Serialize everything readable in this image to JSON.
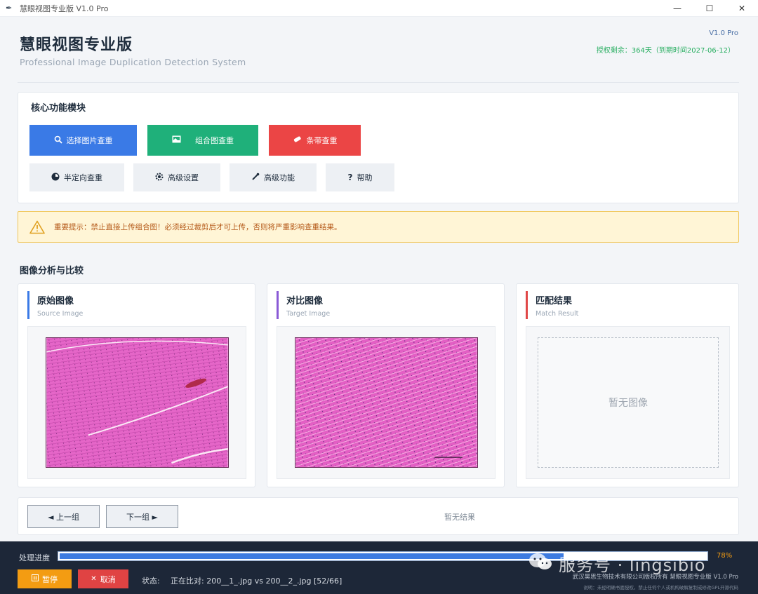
{
  "window": {
    "title": "慧眼视图专业版 V1.0 Pro",
    "app_icon": "feather-icon",
    "controls": {
      "minimize": "—",
      "maximize": "☐",
      "close": "✕"
    }
  },
  "header": {
    "title": "慧眼视图专业版",
    "subtitle": "Professional Image Duplication Detection System",
    "version": "V1.0 Pro",
    "license": "授权剩余：364天（到期时间2027-06-12）"
  },
  "core": {
    "title": "核心功能模块",
    "primary_buttons": [
      {
        "label": "选择图片查重",
        "icon": "search-icon",
        "color": "#3a7ae6"
      },
      {
        "label": "组合图查重",
        "icon": "image-icon",
        "color": "#1fb07a"
      },
      {
        "label": "条带查重",
        "icon": "strip-icon",
        "color": "#eb4545"
      }
    ],
    "secondary_buttons": [
      {
        "label": "半定向查重",
        "icon": "target-icon"
      },
      {
        "label": "高级设置",
        "icon": "gear-icon"
      },
      {
        "label": "高级功能",
        "icon": "wrench-icon"
      },
      {
        "label": "帮助",
        "icon": "question-icon"
      }
    ]
  },
  "warning": {
    "icon": "warning-icon",
    "text": "重要提示：禁止直接上传组合图！必须经过裁剪后才可上传，否则将严重影响查重结果。"
  },
  "analysis": {
    "title": "图像分析与比较",
    "panels": [
      {
        "title": "原始图像",
        "subtitle": "Source Image",
        "accent": "#3a7ae6"
      },
      {
        "title": "对比图像",
        "subtitle": "Target Image",
        "accent": "#8a5ad6"
      },
      {
        "title": "匹配结果",
        "subtitle": "Match Result",
        "accent": "#e04848",
        "empty_text": "暂无图像"
      }
    ]
  },
  "navigation": {
    "prev_label": "◄ 上一组",
    "next_label": "下一组 ►",
    "result_text": "暂无结果"
  },
  "status_bar": {
    "progress_label": "处理进度",
    "progress_percent": 78,
    "progress_text": "78%",
    "pause_label": "暂停",
    "pause_color": "#f39c12",
    "cancel_label": "取消",
    "cancel_color": "#e04343",
    "status_label": "状态:",
    "status_text": "正在比对: 200__1_.jpg vs 200__2_.jpg [52/66]",
    "copyright": "武汉昊思生物技术有限公司版权所有   慧眼视图专业版 V1.0 Pro",
    "disclaimer": "说明：未经明确书面授权，禁止任何个人或机构破解复制或修改GPL开源代码"
  },
  "watermark": {
    "text": "服务号 · lingsibio"
  }
}
